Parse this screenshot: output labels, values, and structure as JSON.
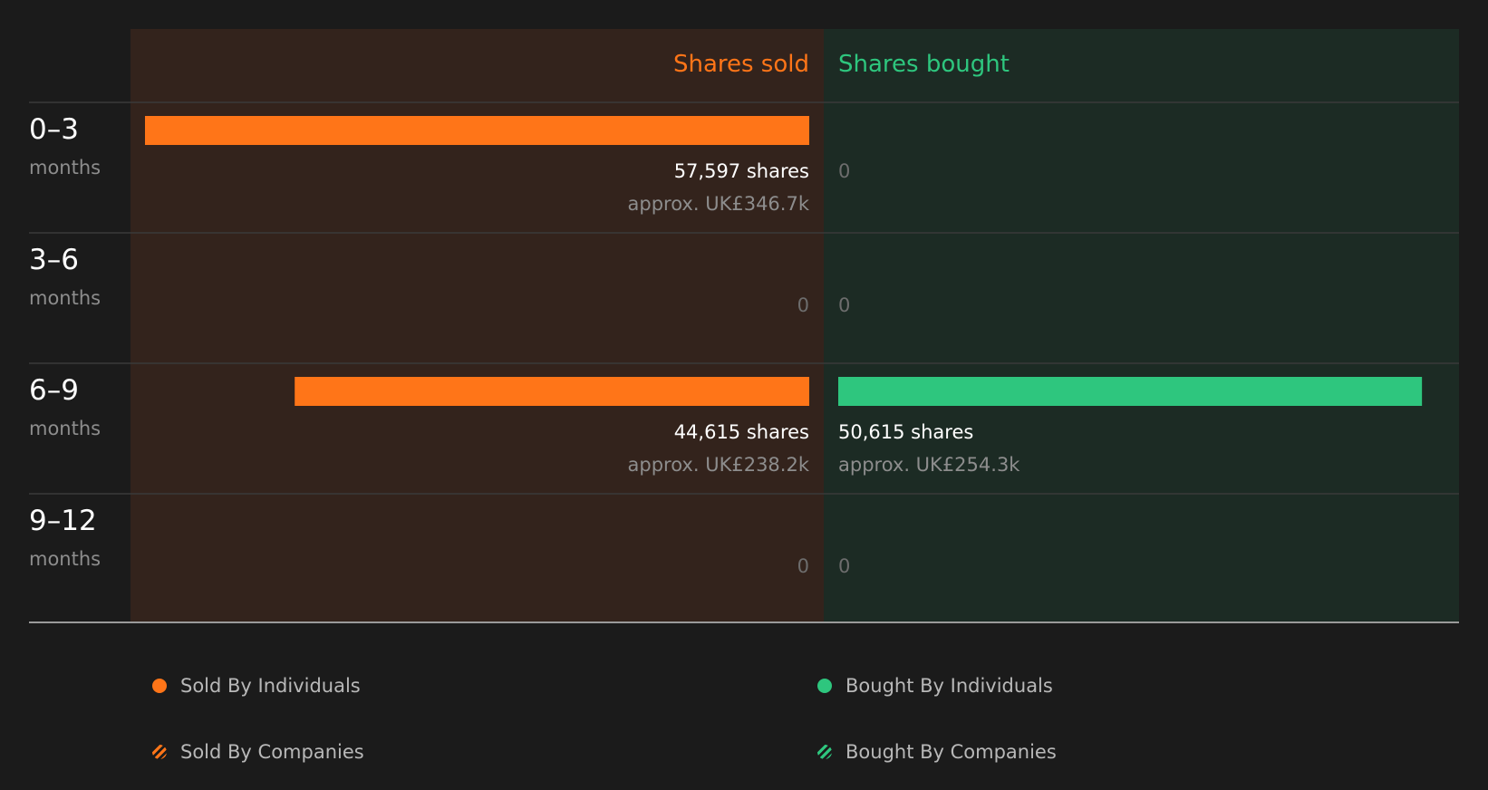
{
  "colors": {
    "sold": "#ff7518",
    "bought": "#2ec67e",
    "sold_panel": "#33231c",
    "bought_panel": "#1c2b24",
    "background": "#1b1b1b",
    "label": "#ffffff",
    "muted": "#8d8d8d",
    "zero": "#6d6d6d"
  },
  "chart_data": {
    "type": "bar",
    "orientation": "horizontal-diverging",
    "column_headers": {
      "sold": "Shares sold",
      "bought": "Shares bought"
    },
    "categories": [
      {
        "range": "0–3",
        "unit": "months"
      },
      {
        "range": "3–6",
        "unit": "months"
      },
      {
        "range": "6–9",
        "unit": "months"
      },
      {
        "range": "9–12",
        "unit": "months"
      }
    ],
    "series": [
      {
        "name": "Shares sold",
        "values": [
          57597,
          0,
          44615,
          0
        ],
        "labels": [
          "57,597 shares",
          "0",
          "44,615 shares",
          "0"
        ],
        "approx": [
          "approx. UK£346.7k",
          "",
          "approx. UK£238.2k",
          ""
        ]
      },
      {
        "name": "Shares bought",
        "values": [
          0,
          0,
          50615,
          0
        ],
        "labels": [
          "0",
          "0",
          "50,615 shares",
          "0"
        ],
        "approx": [
          "",
          "",
          "approx. UK£254.3k",
          ""
        ]
      }
    ],
    "xlim": [
      0,
      57597
    ],
    "legend_position": "bottom"
  },
  "legend": {
    "sold_individuals": "Sold By Individuals",
    "sold_companies": "Sold By Companies",
    "bought_individuals": "Bought By Individuals",
    "bought_companies": "Bought By Companies"
  }
}
